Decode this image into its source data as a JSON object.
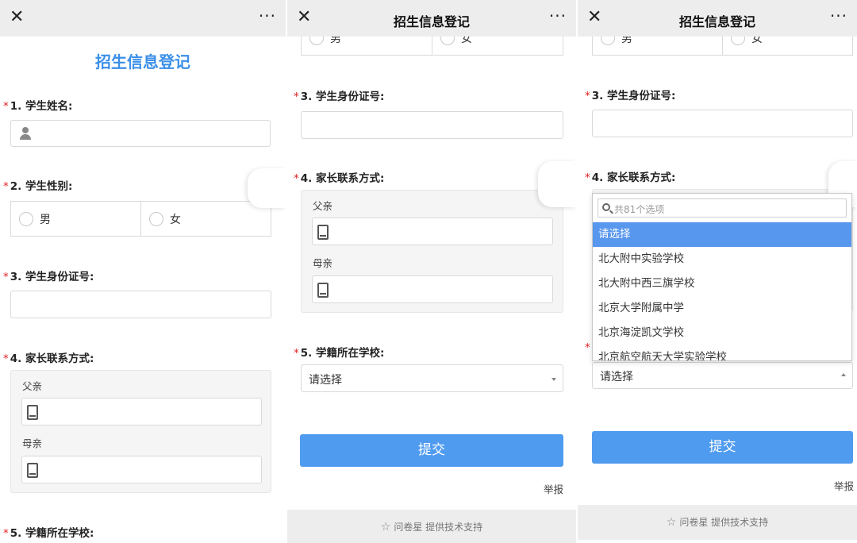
{
  "topbar": {
    "close": "✕",
    "more": "···",
    "title": "招生信息登记"
  },
  "form": {
    "title": "招生信息登记",
    "q1": {
      "star": "*",
      "label": "1. 学生姓名:"
    },
    "q2": {
      "star": "*",
      "label": "2. 学生性别:",
      "options": [
        "男",
        "女"
      ]
    },
    "q3": {
      "star": "*",
      "label": "3. 学生身份证号:"
    },
    "q4": {
      "star": "*",
      "label": "4. 家长联系方式:",
      "father": "父亲",
      "mother": "母亲"
    },
    "q5": {
      "star": "*",
      "label": "5. 学籍所在学校:",
      "select_value": "请选择"
    },
    "submit": "提交",
    "report": "举报",
    "footer": "问卷星 提供技术支持"
  },
  "dropdown": {
    "search_placeholder": "共81个选项",
    "items": [
      "请选择",
      "北大附中实验学校",
      "北大附中西三旗学校",
      "北京大学附属中学",
      "北京海淀凯文学校",
      "北京航空航天大学实验学校"
    ],
    "selected_index": 0
  }
}
